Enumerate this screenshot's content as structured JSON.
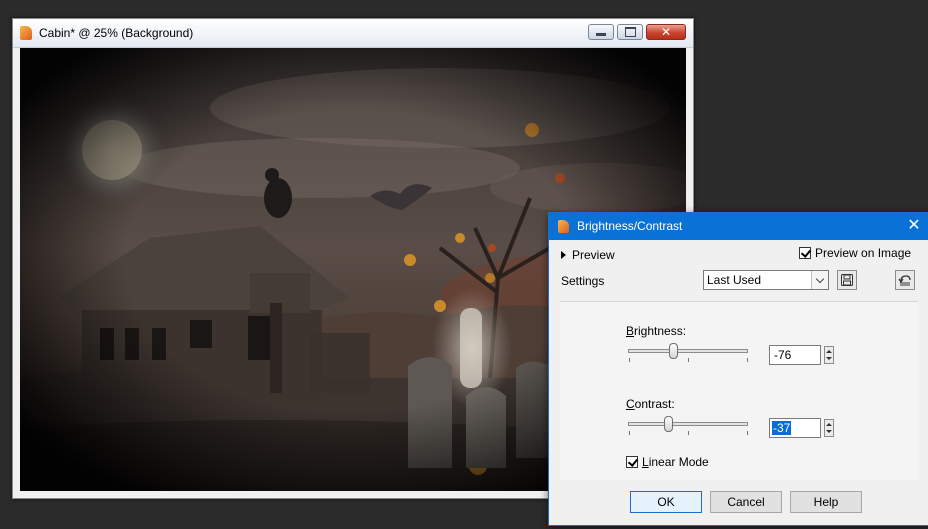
{
  "document_window": {
    "title": "Cabin* @  25% (Background)",
    "icons": {
      "app": "paintshop-pro-icon",
      "minimize": "minimize-icon",
      "maximize": "maximize-icon",
      "close": "close-icon"
    }
  },
  "dialog": {
    "title": "Brightness/Contrast",
    "preview_label": "Preview",
    "preview_on_image_label": "Preview on Image",
    "preview_on_image_checked": true,
    "settings_label": "Settings",
    "settings_value": "Last Used",
    "brightness": {
      "label_accel": "B",
      "label_rest": "rightness:",
      "value": "-76",
      "slider_fraction": 0.37
    },
    "contrast": {
      "label_accel": "C",
      "label_rest": "ontrast:",
      "value": "-37",
      "slider_fraction": 0.32
    },
    "linear_mode": {
      "label_accel": "L",
      "label_rest": "inear Mode",
      "checked": true
    },
    "buttons": {
      "ok": "OK",
      "cancel": "Cancel",
      "help": "Help"
    }
  },
  "colors": {
    "dialog_titlebar": "#0a72d6",
    "selection": "#0a6cd6",
    "workspace": "#2b2b2b"
  }
}
